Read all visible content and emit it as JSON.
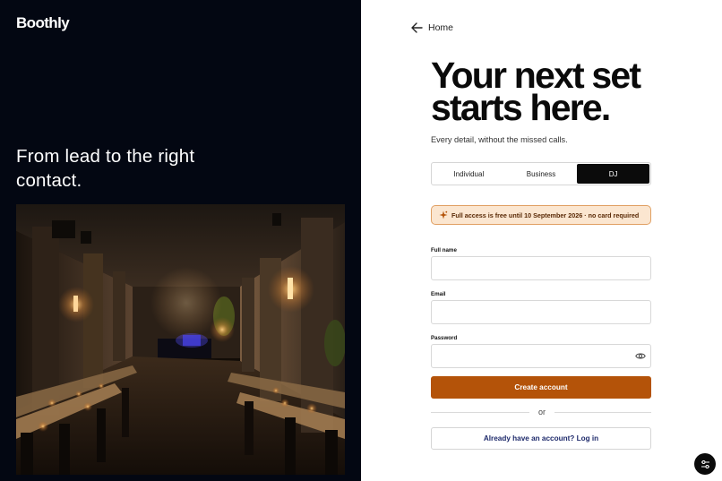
{
  "brand": {
    "logo_text": "Boothly"
  },
  "hero": {
    "tagline": "From lead to the right contact.",
    "image_icon": "restaurant-photo"
  },
  "nav": {
    "home_label": "Home",
    "back_icon": "arrow-left-icon"
  },
  "form": {
    "headline": "Your next set starts here.",
    "subheadline": "Every detail, without the missed calls.",
    "roles": [
      {
        "label": "Individual",
        "active": false
      },
      {
        "label": "Business",
        "active": false
      },
      {
        "label": "DJ",
        "active": true
      }
    ],
    "notice": {
      "icon": "sparkle-icon",
      "text": "Full access is free until 10 September 2026 · no card required"
    },
    "fields": {
      "full_name": {
        "label": "Full name",
        "value": ""
      },
      "email": {
        "label": "Email",
        "value": ""
      },
      "password": {
        "label": "Password",
        "value": "",
        "toggle_icon": "eye-icon"
      }
    },
    "submit_label": "Create account",
    "or_label": "or",
    "login_label": "Already have an account? Log in"
  },
  "floating": {
    "icon": "settings-sliders-icon"
  },
  "colors": {
    "left_panel": "#030712",
    "accent": "#b45309",
    "notice_bg": "#fbe6d0",
    "notice_border": "#e0a063",
    "login_text": "#1e2a6b",
    "active_tab": "#0b0b0b"
  }
}
